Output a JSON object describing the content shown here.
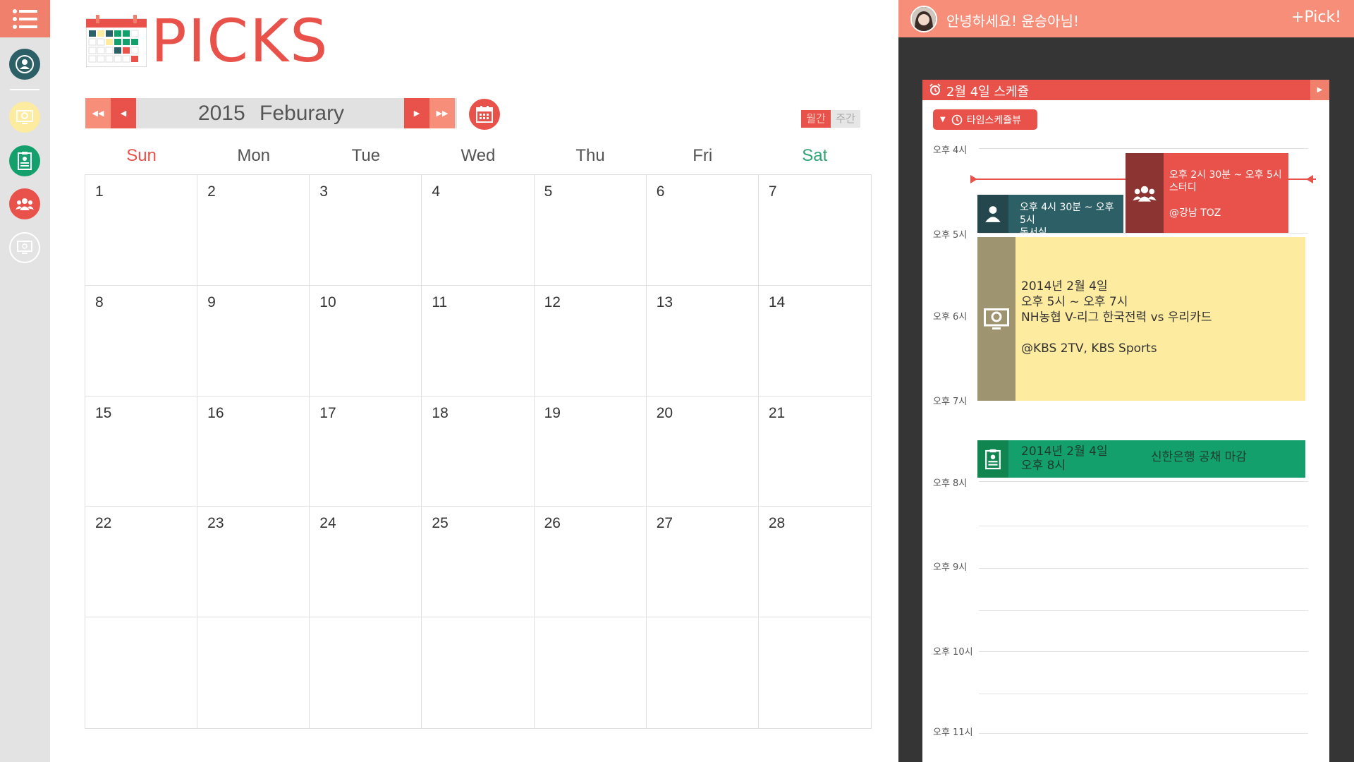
{
  "app": {
    "logo_text": "PICKS"
  },
  "sidebar": {
    "items": [
      {
        "icon": "menu-icon"
      },
      {
        "icon": "user-icon"
      },
      {
        "icon": "tv-icon"
      },
      {
        "icon": "clipboard-icon"
      },
      {
        "icon": "group-icon"
      },
      {
        "icon": "monitor-icon"
      }
    ]
  },
  "calendar": {
    "year": "2015",
    "month": "Feburary",
    "view_month_label": "월간",
    "view_week_label": "주간",
    "weekdays": [
      "Sun",
      "Mon",
      "Tue",
      "Wed",
      "Thu",
      "Fri",
      "Sat"
    ],
    "days": [
      "1",
      "2",
      "3",
      "4",
      "5",
      "6",
      "7",
      "8",
      "9",
      "10",
      "11",
      "12",
      "13",
      "14",
      "15",
      "16",
      "17",
      "18",
      "19",
      "20",
      "21",
      "22",
      "23",
      "24",
      "25",
      "26",
      "27",
      "28",
      "",
      "",
      "",
      "",
      "",
      "",
      ""
    ]
  },
  "header": {
    "greeting": "안녕하세요! 윤승아님!",
    "pick_label": "+Pick!"
  },
  "schedule": {
    "title": "2월 4일 스케쥴",
    "view_toggle": "타임스케쥴뷰",
    "time_labels": [
      "오후 4시",
      "오후 5시",
      "오후 6시",
      "오후 7시",
      "오후 8시",
      "오후 9시",
      "오후 10시",
      "오후 11시"
    ],
    "events": [
      {
        "time": "오후 2시 30분 ~ 오후 5시",
        "title": "스터디",
        "place": "@강남 TOZ",
        "color": "#e8524a",
        "icon": "group-icon"
      },
      {
        "time": "오후 4시 30분 ~ 오후 5시",
        "title": "독서실",
        "color": "#2c5f66",
        "icon": "user-icon"
      },
      {
        "date": "2014년 2월 4일",
        "time": "오후 5시 ~ 오후 7시",
        "title": "NH농협 V-리그 한국전력 vs 우리카드",
        "place": "@KBS 2TV, KBS Sports",
        "color": "#fdeba0",
        "icon": "tv-icon"
      },
      {
        "date": "2014년 2월 4일",
        "time": "오후 8시",
        "title": "신한은행 공채 마감",
        "color": "#14a06d",
        "icon": "clipboard-icon"
      }
    ]
  }
}
